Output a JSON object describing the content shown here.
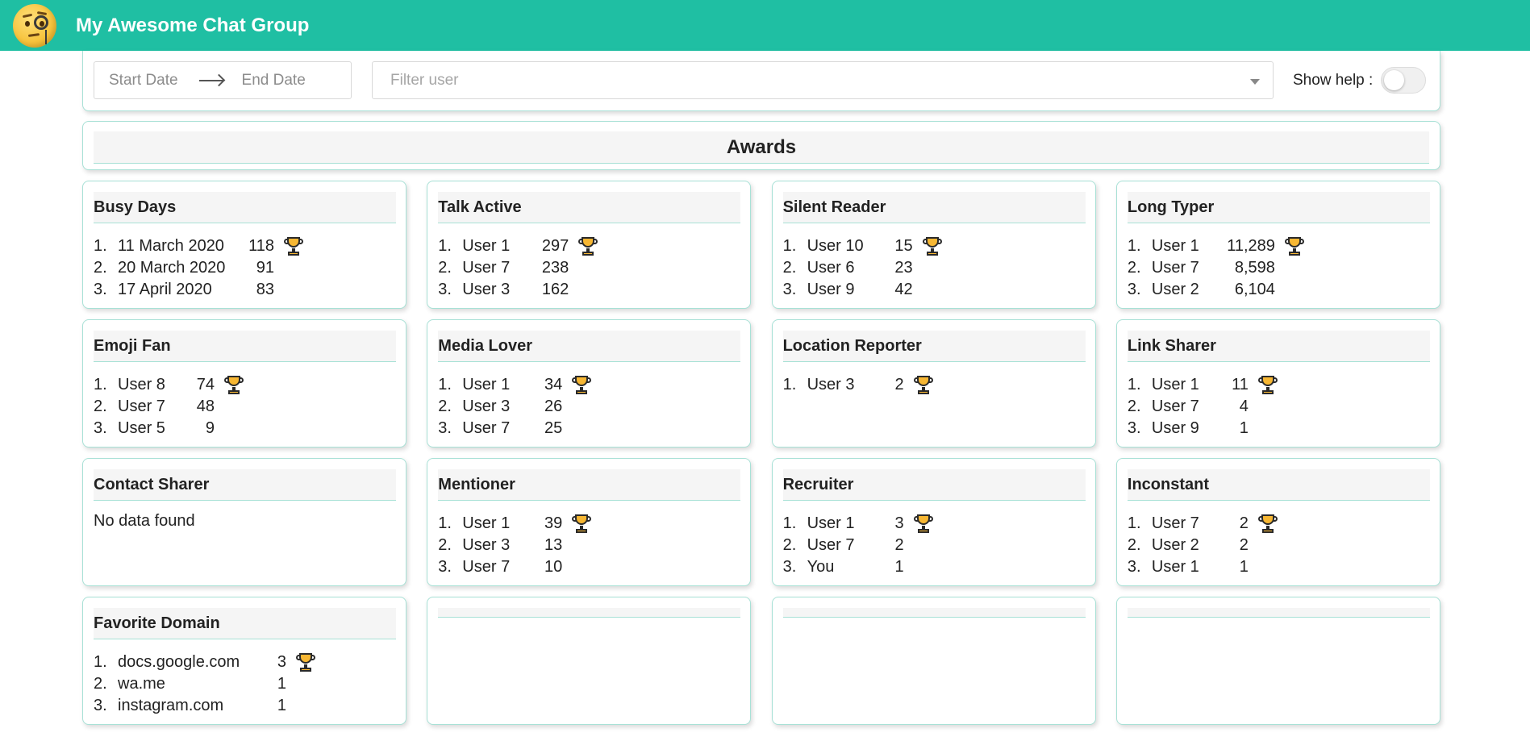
{
  "app": {
    "title": "My Awesome Chat Group"
  },
  "filters": {
    "start_date_placeholder": "Start Date",
    "end_date_placeholder": "End Date",
    "user_placeholder": "Filter user",
    "show_help_label": "Show help :",
    "show_help_on": false
  },
  "awards": {
    "title": "Awards"
  },
  "cards": [
    {
      "title": "Busy Days",
      "rows": [
        {
          "rank": "1.",
          "name": "11 March 2020",
          "value": "118",
          "trophy": true
        },
        {
          "rank": "2.",
          "name": "20 March 2020",
          "value": "91"
        },
        {
          "rank": "3.",
          "name": "17 April 2020",
          "value": "83"
        }
      ]
    },
    {
      "title": "Talk Active",
      "rows": [
        {
          "rank": "1.",
          "name": "User 1",
          "value": "297",
          "trophy": true
        },
        {
          "rank": "2.",
          "name": "User 7",
          "value": "238"
        },
        {
          "rank": "3.",
          "name": "User 3",
          "value": "162"
        }
      ]
    },
    {
      "title": "Silent Reader",
      "rows": [
        {
          "rank": "1.",
          "name": "User 10",
          "value": "15",
          "trophy": true
        },
        {
          "rank": "2.",
          "name": "User 6",
          "value": "23"
        },
        {
          "rank": "3.",
          "name": "User 9",
          "value": "42"
        }
      ]
    },
    {
      "title": "Long Typer",
      "rows": [
        {
          "rank": "1.",
          "name": "User 1",
          "value": "11,289",
          "trophy": true
        },
        {
          "rank": "2.",
          "name": "User 7",
          "value": "8,598"
        },
        {
          "rank": "3.",
          "name": "User 2",
          "value": "6,104"
        }
      ]
    },
    {
      "title": "Emoji Fan",
      "rows": [
        {
          "rank": "1.",
          "name": "User 8",
          "value": "74",
          "trophy": true
        },
        {
          "rank": "2.",
          "name": "User 7",
          "value": "48"
        },
        {
          "rank": "3.",
          "name": "User 5",
          "value": "9"
        }
      ]
    },
    {
      "title": "Media Lover",
      "rows": [
        {
          "rank": "1.",
          "name": "User 1",
          "value": "34",
          "trophy": true
        },
        {
          "rank": "2.",
          "name": "User 3",
          "value": "26"
        },
        {
          "rank": "3.",
          "name": "User 7",
          "value": "25"
        }
      ]
    },
    {
      "title": "Location Reporter",
      "rows": [
        {
          "rank": "1.",
          "name": "User 3",
          "value": "2",
          "trophy": true
        }
      ]
    },
    {
      "title": "Link Sharer",
      "rows": [
        {
          "rank": "1.",
          "name": "User 1",
          "value": "11",
          "trophy": true
        },
        {
          "rank": "2.",
          "name": "User 7",
          "value": "4"
        },
        {
          "rank": "3.",
          "name": "User 9",
          "value": "1"
        }
      ]
    },
    {
      "title": "Contact Sharer",
      "empty_text": "No data found",
      "rows": []
    },
    {
      "title": "Mentioner",
      "rows": [
        {
          "rank": "1.",
          "name": "User 1",
          "value": "39",
          "trophy": true
        },
        {
          "rank": "2.",
          "name": "User 3",
          "value": "13"
        },
        {
          "rank": "3.",
          "name": "User 7",
          "value": "10"
        }
      ]
    },
    {
      "title": "Recruiter",
      "rows": [
        {
          "rank": "1.",
          "name": "User 1",
          "value": "3",
          "trophy": true
        },
        {
          "rank": "2.",
          "name": "User 7",
          "value": "2"
        },
        {
          "rank": "3.",
          "name": "You",
          "value": "1"
        }
      ]
    },
    {
      "title": "Inconstant",
      "rows": [
        {
          "rank": "1.",
          "name": "User 7",
          "value": "2",
          "trophy": true
        },
        {
          "rank": "2.",
          "name": "User 2",
          "value": "2"
        },
        {
          "rank": "3.",
          "name": "User 1",
          "value": "1"
        }
      ]
    },
    {
      "title": "Favorite Domain",
      "rows": [
        {
          "rank": "1.",
          "name": "docs.google.com",
          "value": "3",
          "trophy": true
        },
        {
          "rank": "2.",
          "name": "wa.me",
          "value": "1"
        },
        {
          "rank": "3.",
          "name": "instagram.com",
          "value": "1"
        }
      ]
    },
    {
      "title": "",
      "rows": []
    },
    {
      "title": "",
      "rows": []
    },
    {
      "title": "",
      "rows": []
    }
  ],
  "icons": {
    "app_logo": "monocle-face-emoji-icon",
    "trophy": "trophy-icon",
    "date_arrow": "arrow-right-icon",
    "dropdown": "chevron-down-icon"
  },
  "colors": {
    "header": "#1fbfa3",
    "card_border": "#a8e1d6",
    "trophy": "#f7b733"
  }
}
